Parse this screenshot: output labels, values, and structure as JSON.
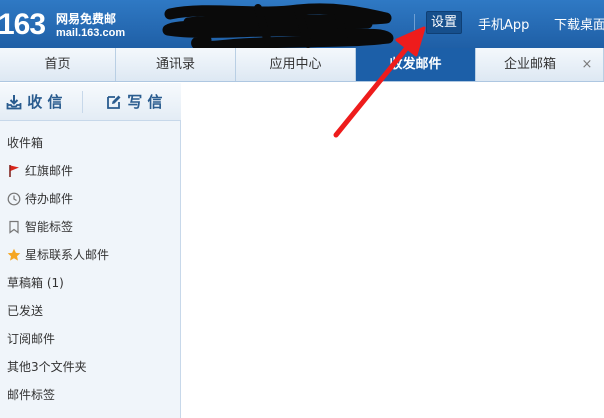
{
  "header": {
    "logo_number": "163",
    "logo_name": "网易免费邮",
    "logo_domain": "mail.163.com",
    "settings_label": "设置",
    "mobile_app_label": "手机App",
    "download_label": "下载桌面"
  },
  "tabs": [
    {
      "label": "首页"
    },
    {
      "label": "通讯录"
    },
    {
      "label": "应用中心"
    },
    {
      "label": "收发邮件"
    },
    {
      "label": "企业邮箱"
    }
  ],
  "tab_close_symbol": "×",
  "sidebar": {
    "receive_label": "收 信",
    "compose_label": "写 信",
    "folders": [
      {
        "label": "收件箱",
        "icon": "none"
      },
      {
        "label": "红旗邮件",
        "icon": "red-flag-icon"
      },
      {
        "label": "待办邮件",
        "icon": "clock-icon"
      },
      {
        "label": "智能标签",
        "icon": "bookmark-icon"
      },
      {
        "label": "星标联系人邮件",
        "icon": "star-icon"
      },
      {
        "label": "草稿箱 (1)",
        "icon": "none"
      },
      {
        "label": "已发送",
        "icon": "none"
      },
      {
        "label": "订阅邮件",
        "icon": "none"
      },
      {
        "label": "其他3个文件夹",
        "icon": "none"
      },
      {
        "label": "邮件标签",
        "icon": "none"
      }
    ]
  },
  "colors": {
    "header_blue": "#1f5fa6",
    "active_tab": "#1c5fa8",
    "annotation_arrow": "#ee1c1c",
    "flag_red": "#d9261c",
    "star_orange": "#f5a623"
  }
}
